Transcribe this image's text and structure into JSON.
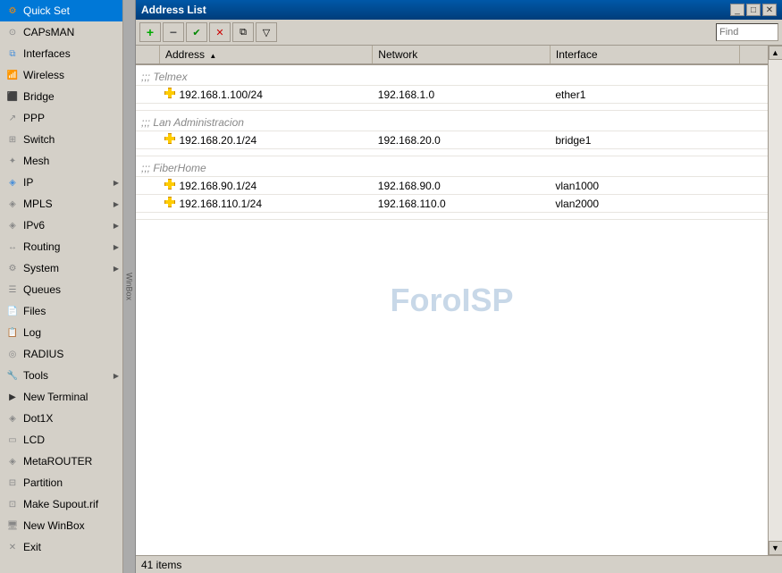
{
  "sidebar": {
    "items": [
      {
        "id": "quick-set",
        "label": "Quick Set",
        "icon": "⚙",
        "iconClass": "icon-quickset",
        "hasSubmenu": false
      },
      {
        "id": "capsman",
        "label": "CAPsMAN",
        "icon": "◉",
        "iconClass": "icon-capsman",
        "hasSubmenu": false
      },
      {
        "id": "interfaces",
        "label": "Interfaces",
        "icon": "⊞",
        "iconClass": "icon-interfaces",
        "hasSubmenu": false
      },
      {
        "id": "wireless",
        "label": "Wireless",
        "icon": "((◉))",
        "iconClass": "icon-wireless",
        "hasSubmenu": false
      },
      {
        "id": "bridge",
        "label": "Bridge",
        "icon": "⊟",
        "iconClass": "icon-bridge",
        "hasSubmenu": false
      },
      {
        "id": "ppp",
        "label": "PPP",
        "icon": "⤷",
        "iconClass": "icon-ppp",
        "hasSubmenu": false
      },
      {
        "id": "switch",
        "label": "Switch",
        "icon": "⊞",
        "iconClass": "icon-switch",
        "hasSubmenu": false
      },
      {
        "id": "mesh",
        "label": "Mesh",
        "icon": "✦",
        "iconClass": "icon-mesh",
        "hasSubmenu": false
      },
      {
        "id": "ip",
        "label": "IP",
        "icon": "◈",
        "iconClass": "icon-ip",
        "hasSubmenu": true
      },
      {
        "id": "mpls",
        "label": "MPLS",
        "icon": "◈",
        "iconClass": "icon-mpls",
        "hasSubmenu": true
      },
      {
        "id": "ipv6",
        "label": "IPv6",
        "icon": "◈",
        "iconClass": "icon-ipv6",
        "hasSubmenu": true
      },
      {
        "id": "routing",
        "label": "Routing",
        "icon": "↔",
        "iconClass": "icon-routing",
        "hasSubmenu": true
      },
      {
        "id": "system",
        "label": "System",
        "icon": "⚙",
        "iconClass": "icon-system",
        "hasSubmenu": true
      },
      {
        "id": "queues",
        "label": "Queues",
        "icon": "≡",
        "iconClass": "icon-queues",
        "hasSubmenu": false
      },
      {
        "id": "files",
        "label": "Files",
        "icon": "📄",
        "iconClass": "icon-files",
        "hasSubmenu": false
      },
      {
        "id": "log",
        "label": "Log",
        "icon": "📋",
        "iconClass": "icon-log",
        "hasSubmenu": false
      },
      {
        "id": "radius",
        "label": "RADIUS",
        "icon": "◎",
        "iconClass": "icon-radius",
        "hasSubmenu": false
      },
      {
        "id": "tools",
        "label": "Tools",
        "icon": "🔧",
        "iconClass": "icon-tools",
        "hasSubmenu": true
      },
      {
        "id": "new-terminal",
        "label": "New Terminal",
        "icon": "▶",
        "iconClass": "icon-newterminal",
        "hasSubmenu": false
      },
      {
        "id": "dot1x",
        "label": "Dot1X",
        "icon": "◈",
        "iconClass": "icon-dot1x",
        "hasSubmenu": false
      },
      {
        "id": "lcd",
        "label": "LCD",
        "icon": "▭",
        "iconClass": "icon-lcd",
        "hasSubmenu": false
      },
      {
        "id": "metarouter",
        "label": "MetaROUTER",
        "icon": "◈",
        "iconClass": "icon-metarouter",
        "hasSubmenu": false
      },
      {
        "id": "partition",
        "label": "Partition",
        "icon": "⊟",
        "iconClass": "icon-partition",
        "hasSubmenu": false
      },
      {
        "id": "make-supout",
        "label": "Make Supout.rif",
        "icon": "📦",
        "iconClass": "icon-makesupout",
        "hasSubmenu": false
      },
      {
        "id": "new-winbox",
        "label": "New WinBox",
        "icon": "🖥",
        "iconClass": "icon-newwinbox",
        "hasSubmenu": false
      },
      {
        "id": "exit",
        "label": "Exit",
        "icon": "✕",
        "iconClass": "icon-exit",
        "hasSubmenu": false
      }
    ]
  },
  "window": {
    "title": "Address List",
    "controls": {
      "minimize": "_",
      "maximize": "□",
      "close": "✕"
    }
  },
  "toolbar": {
    "add_icon": "+",
    "remove_icon": "−",
    "check_icon": "✔",
    "cross_icon": "✕",
    "copy_icon": "⧉",
    "filter_icon": "▽",
    "find_placeholder": "Find"
  },
  "table": {
    "columns": [
      {
        "id": "col-check",
        "label": ""
      },
      {
        "id": "col-address",
        "label": "Address",
        "sortable": true
      },
      {
        "id": "col-network",
        "label": "Network"
      },
      {
        "id": "col-interface",
        "label": "Interface"
      },
      {
        "id": "col-extra",
        "label": ""
      }
    ],
    "sections": [
      {
        "comment": ";;; Telmex",
        "rows": [
          {
            "address": "192.168.1.100/24",
            "network": "192.168.1.0",
            "interface": "ether1",
            "hasIcon": true
          }
        ]
      },
      {
        "comment": ";;; Lan Administracion",
        "rows": [
          {
            "address": "192.168.20.1/24",
            "network": "192.168.20.0",
            "interface": "bridge1",
            "hasIcon": true
          }
        ]
      },
      {
        "comment": ";;; FiberHome",
        "rows": [
          {
            "address": "192.168.90.1/24",
            "network": "192.168.90.0",
            "interface": "vlan1000",
            "hasIcon": true
          },
          {
            "address": "192.168.110.1/24",
            "network": "192.168.110.0",
            "interface": "vlan2000",
            "hasIcon": true
          }
        ]
      }
    ]
  },
  "statusbar": {
    "text": "41 items"
  },
  "watermark": {
    "text": "ForoISP"
  },
  "winbox_strip": {
    "label": "WinBox"
  }
}
